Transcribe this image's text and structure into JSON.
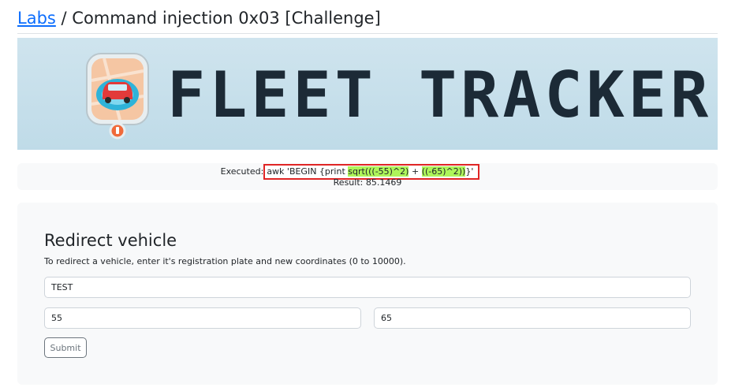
{
  "header": {
    "breadcrumb_link": "Labs",
    "separator": " / ",
    "page_title": "Command injection 0x03 [Challenge]"
  },
  "banner": {
    "brand_text": "FLEET TRACKER",
    "icon": "map-pin-car-icon"
  },
  "execution": {
    "label": "Executed:",
    "cmd_part1": "awk 'BEGIN {print ",
    "cmd_hl1": "sqrt(((-55)^2)",
    "cmd_part2": " + ",
    "cmd_hl2": "((-65)^2))",
    "cmd_part3": "}'",
    "result": "Result: 85.1469"
  },
  "form": {
    "heading": "Redirect vehicle",
    "description": "To redirect a vehicle, enter it's registration plate and new coordinates (0 to 10000).",
    "plate_value": "TEST",
    "x_value": "55",
    "y_value": "65",
    "submit_label": "Submit"
  },
  "colors": {
    "link": "#0d6efd",
    "highlight": "#aef55a",
    "annotation_border": "#e02525",
    "banner_bg": "#c6e0ec",
    "banner_text": "#1c2a36"
  }
}
